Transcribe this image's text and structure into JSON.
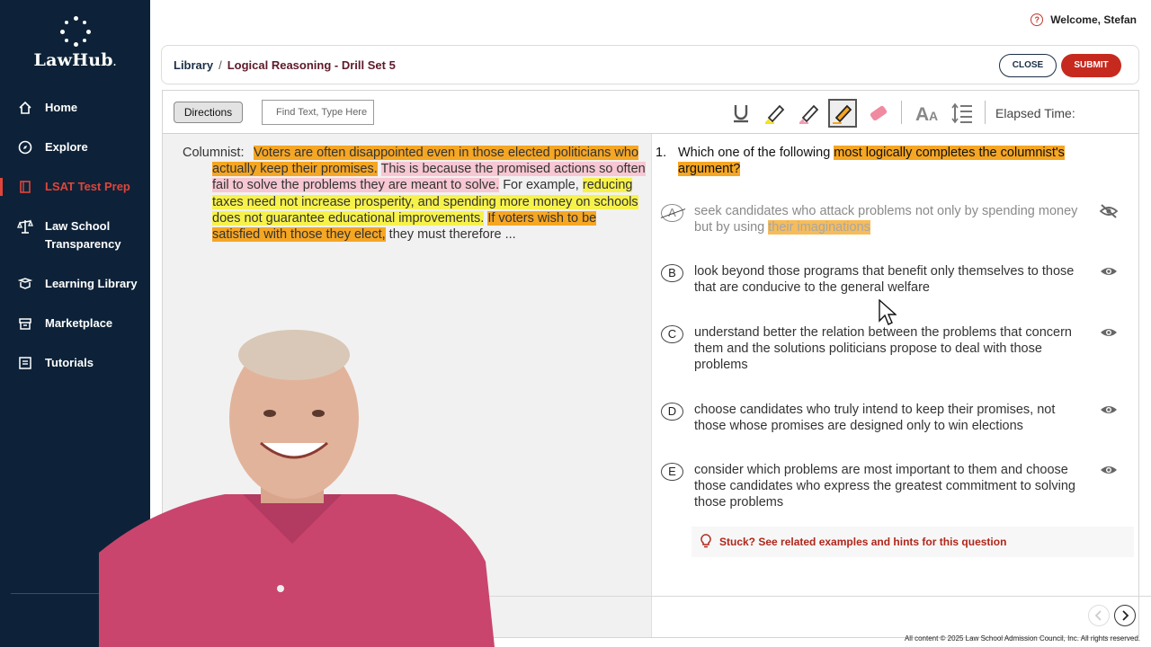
{
  "brand": {
    "name": "LawHub",
    "suffix": "."
  },
  "sidebar": {
    "items": [
      {
        "label": "Home",
        "icon": "home-icon"
      },
      {
        "label": "Explore",
        "icon": "compass-icon"
      },
      {
        "label": "LSAT Test Prep",
        "icon": "book-icon",
        "active": true
      },
      {
        "label": "Law School Transparency",
        "icon": "scales-icon"
      },
      {
        "label": "Learning Library",
        "icon": "library-icon"
      },
      {
        "label": "Marketplace",
        "icon": "store-icon"
      },
      {
        "label": "Tutorials",
        "icon": "tutorials-icon"
      }
    ]
  },
  "header": {
    "welcome": "Welcome, Stefan"
  },
  "breadcrumb": {
    "root": "Library",
    "separator": "/",
    "current": "Logical Reasoning - Drill Set 5"
  },
  "actions": {
    "close": "CLOSE",
    "submit": "SUBMIT"
  },
  "toolbar": {
    "directions": "Directions",
    "find_placeholder": "Find Text, Type Here",
    "elapsed_label": "Elapsed Time:"
  },
  "passage": {
    "speaker": "Columnist:",
    "segments": [
      {
        "text": "Voters are often disappointed even in those elected politicians who actually keep their promises.",
        "highlight": "orange"
      },
      {
        "text": "This is because the promised actions so often fail to solve the problems they are meant to solve.",
        "highlight": "pink"
      },
      {
        "text": "For example,",
        "highlight": "none"
      },
      {
        "text": "reducing taxes need not increase prosperity, and spending more money on schools does not guarantee educational improvements.",
        "highlight": "yellow"
      },
      {
        "text": "If voters wish to be satisfied with those they elect,",
        "highlight": "orange"
      },
      {
        "text": "they must therefore ...",
        "highlight": "none"
      }
    ]
  },
  "question": {
    "number": "1.",
    "stem_plain": "Which one of the following",
    "stem_highlight": "most logically completes the columnist's argument?",
    "answers": [
      {
        "letter": "A",
        "text": "seek candidates who attack problems not only by spending money but by using",
        "highlight": "their imaginations",
        "eliminated": true
      },
      {
        "letter": "B",
        "text": "look beyond those programs that benefit only themselves to those that are conducive to the general welfare",
        "eliminated": false
      },
      {
        "letter": "C",
        "text": "understand better the relation between the problems that concern them and the solutions politicians propose to deal with those problems",
        "eliminated": false
      },
      {
        "letter": "D",
        "text": "choose candidates who truly intend to keep their promises, not those whose promises are designed only to win elections",
        "eliminated": false
      },
      {
        "letter": "E",
        "text": "consider which problems are most important to them and choose those candidates who express the greatest commitment to solving those problems",
        "eliminated": false
      }
    ],
    "hint": "Stuck? See related examples and hints for this question"
  },
  "footer": {
    "copyright": "All content © 2025 Law School Admission Council, Inc. All rights reserved."
  },
  "colors": {
    "sidebar_bg": "#0d2238",
    "accent_red": "#c62a1f",
    "highlight_orange": "#f5a623",
    "highlight_pink": "#f7c7d3",
    "highlight_yellow": "#f7f24a"
  }
}
